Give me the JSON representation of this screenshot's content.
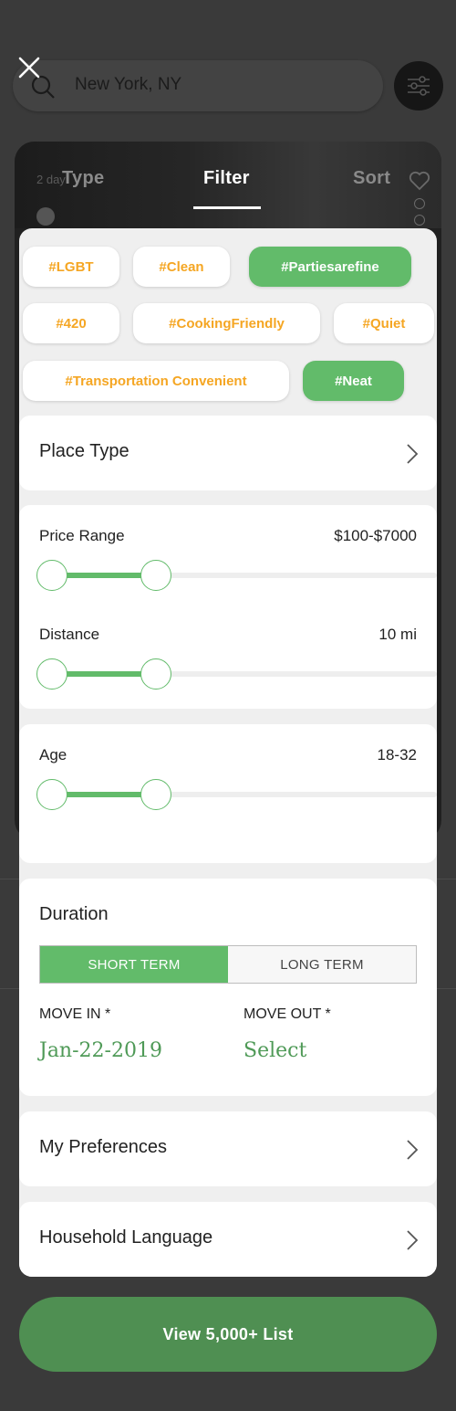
{
  "search": {
    "location": "New York, NY"
  },
  "background": {
    "card_label": "2 day"
  },
  "tabs": [
    {
      "label": "Type"
    },
    {
      "label": "Filter"
    },
    {
      "label": "Sort"
    }
  ],
  "tags": [
    {
      "label": "#LGBT",
      "selected": false
    },
    {
      "label": "#Clean",
      "selected": false
    },
    {
      "label": "#Partiesarefine",
      "selected": true
    },
    {
      "label": "#420",
      "selected": false
    },
    {
      "label": "#CookingFriendly",
      "selected": false
    },
    {
      "label": "#Quiet",
      "selected": false
    },
    {
      "label": "#Transportation Convenient",
      "selected": false
    },
    {
      "label": "#Neat",
      "selected": true
    }
  ],
  "place_type": {
    "label": "Place Type"
  },
  "price_range": {
    "label": "Price Range",
    "value": "$100-$7000"
  },
  "distance": {
    "label": "Distance",
    "value": "10 mi"
  },
  "age": {
    "label": "Age",
    "value": "18-32"
  },
  "duration": {
    "label": "Duration",
    "short_term": "SHORT TERM",
    "long_term": "LONG TERM",
    "selected": "SHORT TERM",
    "move_in_label": "MOVE IN *",
    "move_in_value": "Jan-22-2019",
    "move_out_label": "MOVE OUT *",
    "move_out_value": "Select"
  },
  "preferences": {
    "label": "My Preferences"
  },
  "household_language": {
    "label": "Household Language"
  },
  "cta": {
    "label": "View 5,000+ List"
  },
  "colors": {
    "accent_green": "#62bb6a",
    "tag_orange": "#f5a623",
    "cta_green": "#4f8f52",
    "date_green": "#4f9a57"
  }
}
